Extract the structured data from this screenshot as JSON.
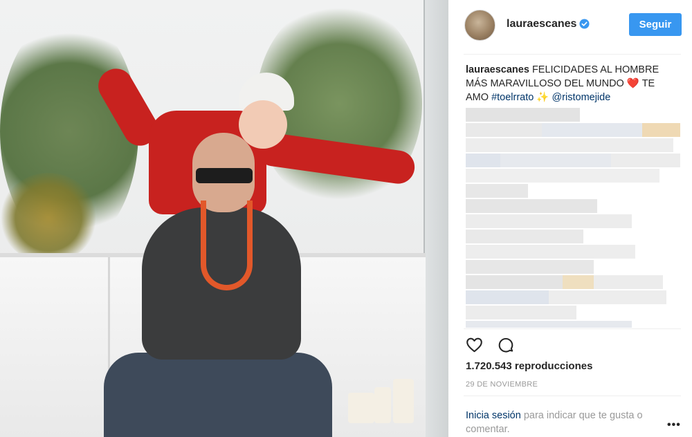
{
  "post": {
    "username": "lauraescanes",
    "follow_label": "Seguir",
    "caption": {
      "user": "lauraescanes",
      "text": "FELICIDADES AL HOMBRE MÁS MARAVILLOSO DEL MUNDO",
      "emoji_heart": "❤️",
      "text2": "TE AMO",
      "hashtag": "#toelrrato",
      "emoji_sparkles": "✨",
      "mention": "@ristomejide"
    },
    "views": "1.720.543 reproducciones",
    "date": "29 DE NOVIEMBRE",
    "login_link": "Inicia sesión",
    "login_rest": "para indicar que te gusta o comentar.",
    "more": "•••"
  },
  "colors": {
    "accent": "#3897f0",
    "link": "#003569",
    "muted": "#999999",
    "verified": "#3897f0"
  },
  "icons": {
    "like": "heart-outline-icon",
    "comment": "speech-bubble-icon",
    "verified": "verified-badge-icon",
    "more": "ellipsis-icon"
  }
}
